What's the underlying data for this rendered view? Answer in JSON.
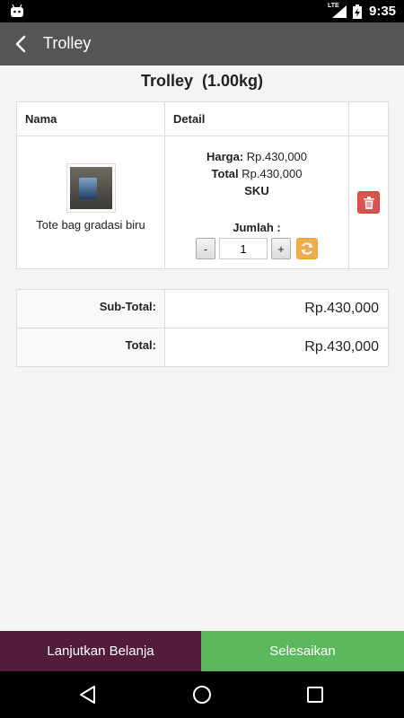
{
  "status_bar": {
    "network": "LTE",
    "time": "9:35"
  },
  "toolbar": {
    "title": "Trolley",
    "icons": {
      "back": "arrow-left-icon"
    }
  },
  "page": {
    "title": "Trolley  (1.00kg)"
  },
  "cart": {
    "headers": [
      "Nama",
      "Detail",
      ""
    ],
    "items": [
      {
        "name": "Tote bag gradasi biru",
        "price_label": "Harga:",
        "price": " Rp.430,000",
        "total_label": "Total",
        "total": " Rp.430,000",
        "sku_label": "SKU",
        "qty_label": "Jumlah :",
        "qty_value": "1",
        "minus": "-",
        "plus": "+"
      }
    ]
  },
  "totals": {
    "subtotal_label": "Sub-Total:",
    "subtotal_value": "Rp.430,000",
    "total_label": "Total:",
    "total_value": "Rp.430,000"
  },
  "actions": {
    "continue": "Lanjutkan Belanja",
    "finish": "Selesaikan"
  },
  "colors": {
    "toolbar": "#555555",
    "continue_bg": "#531c3a",
    "finish_bg": "#5cb85c",
    "delete": "#d9534f",
    "refresh": "#f0ad4e"
  }
}
